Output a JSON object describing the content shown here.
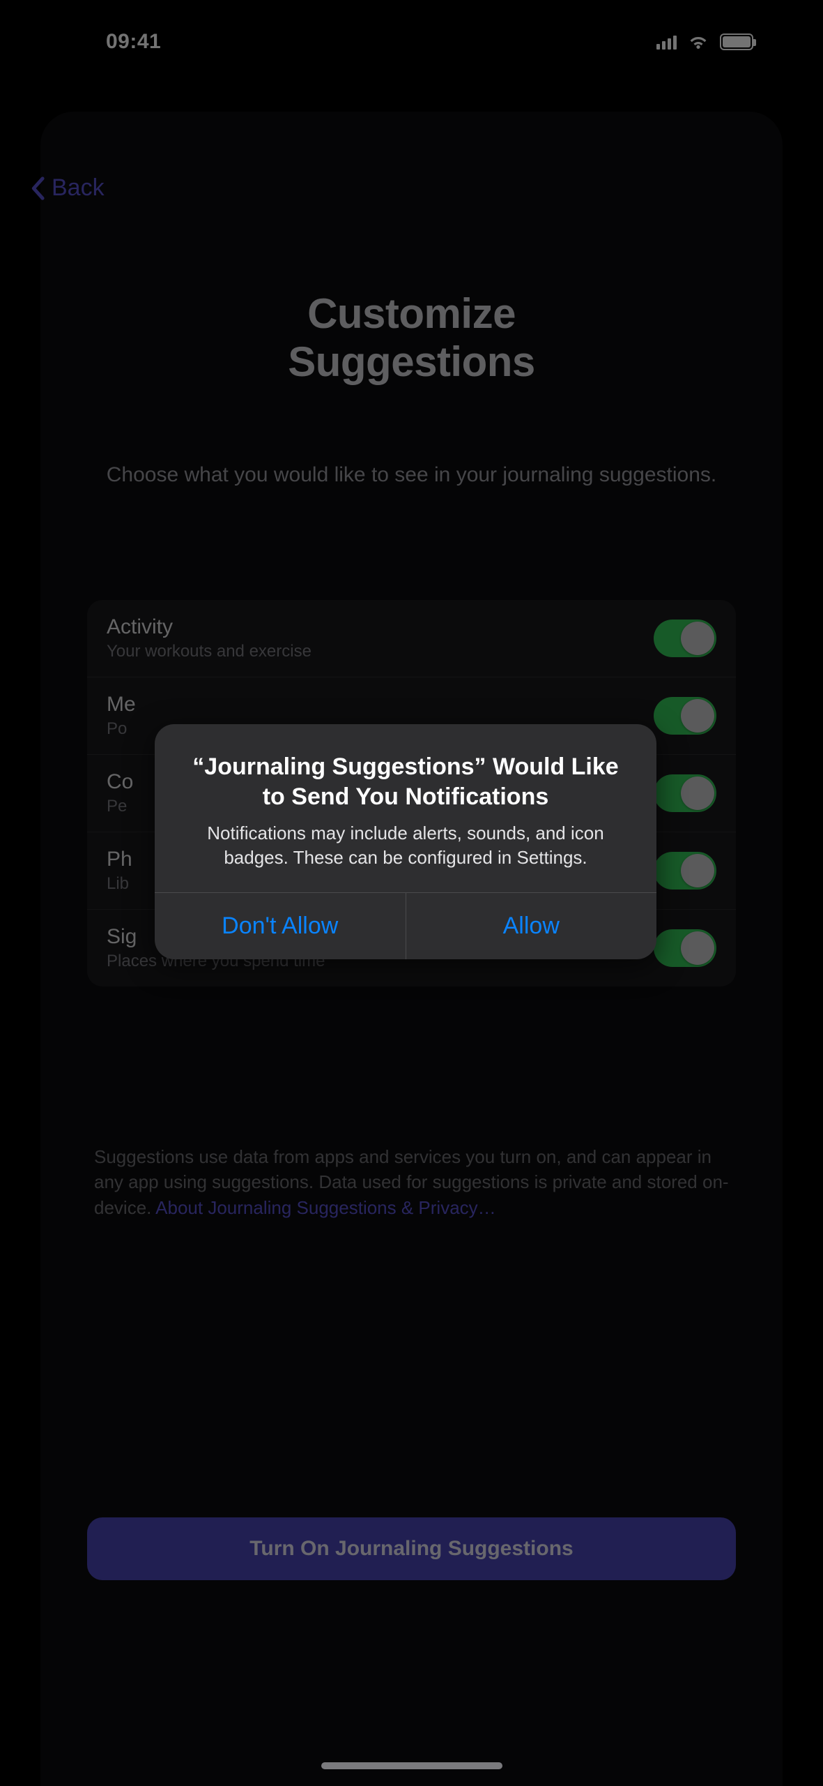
{
  "status": {
    "time": "09:41"
  },
  "nav": {
    "back": "Back"
  },
  "page": {
    "title_line1": "Customize",
    "title_line2": "Suggestions",
    "subtitle": "Choose what you would like to see in your journaling suggestions."
  },
  "settings": [
    {
      "label": "Activity",
      "sub": "Your workouts and exercise"
    },
    {
      "label": "Me",
      "sub": "Po"
    },
    {
      "label": "Co",
      "sub": "Pe"
    },
    {
      "label": "Ph",
      "sub": "Lib"
    },
    {
      "label": "Sig",
      "sub": "Places where you spend time"
    }
  ],
  "footer": {
    "text": "Suggestions use data from apps and services you turn on, and can appear in any app using suggestions. Data used for suggestions is private and stored on-device. ",
    "link": "About Journaling Suggestions & Privacy…"
  },
  "primary_button": "Turn On Journaling Suggestions",
  "alert": {
    "title": "“Journaling Suggestions” Would Like to Send You Notifications",
    "message": "Notifications may include alerts, sounds, and icon badges. These can be configured in Settings.",
    "dont_allow": "Don't Allow",
    "allow": "Allow"
  }
}
